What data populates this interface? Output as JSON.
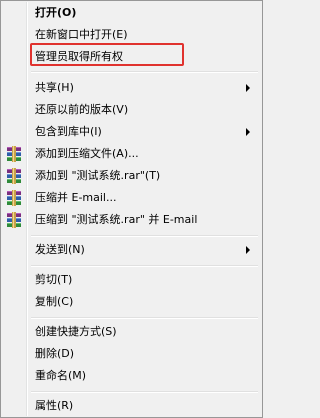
{
  "menu": {
    "items": [
      {
        "label": "打开(O)"
      },
      {
        "label": "在新窗口中打开(E)"
      },
      {
        "label": "管理员取得所有权"
      },
      {
        "label": "共享(H)"
      },
      {
        "label": "还原以前的版本(V)"
      },
      {
        "label": "包含到库中(I)"
      },
      {
        "label": "添加到压缩文件(A)..."
      },
      {
        "label": "添加到 \"测试系统.rar\"(T)"
      },
      {
        "label": "压缩并 E-mail..."
      },
      {
        "label": "压缩到 \"测试系统.rar\" 并 E-mail"
      },
      {
        "label": "发送到(N)"
      },
      {
        "label": "剪切(T)"
      },
      {
        "label": "复制(C)"
      },
      {
        "label": "创建快捷方式(S)"
      },
      {
        "label": "删除(D)"
      },
      {
        "label": "重命名(M)"
      },
      {
        "label": "属性(R)"
      }
    ]
  },
  "colors": {
    "highlight_border": "#e0322e",
    "menu_background": "#f0f0f0"
  },
  "icons": {
    "archive": "winrar-icon",
    "submenu": "submenu-arrow-icon"
  }
}
